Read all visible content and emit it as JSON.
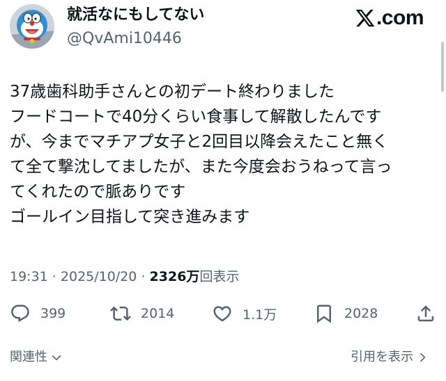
{
  "author": {
    "display_name": "就活なにもしてない",
    "handle": "@QvAmi10446"
  },
  "brand": {
    "label": ".com"
  },
  "tweet": {
    "lines": [
      "37歳歯科助手さんとの初デート終わりました",
      "フードコートで40分くらい食事して解散したんです",
      "が、今までマチアプ女子と2回目以降会えたこと無く",
      "て全て撃沈してましたが、また今度会おうねって言っ",
      "てくれたので脈ありです",
      "ゴールイン目指して突き進みます"
    ],
    "time": "19:31",
    "separator": " · ",
    "date": "2025/10/20",
    "views_count": "2326",
    "views_unit": "万",
    "views_label": "回表示"
  },
  "actions": {
    "reply_count": "399",
    "retweet_count": "2014",
    "like_count": "1.1万",
    "bookmark_count": "2028"
  },
  "footer": {
    "related_label": "関連性",
    "quotes_label": "引用を表示"
  },
  "icons": [
    "reply-icon",
    "retweet-icon",
    "like-icon",
    "bookmark-icon",
    "share-icon",
    "x-logo-icon",
    "chevron-down-icon",
    "chevron-right-icon"
  ]
}
